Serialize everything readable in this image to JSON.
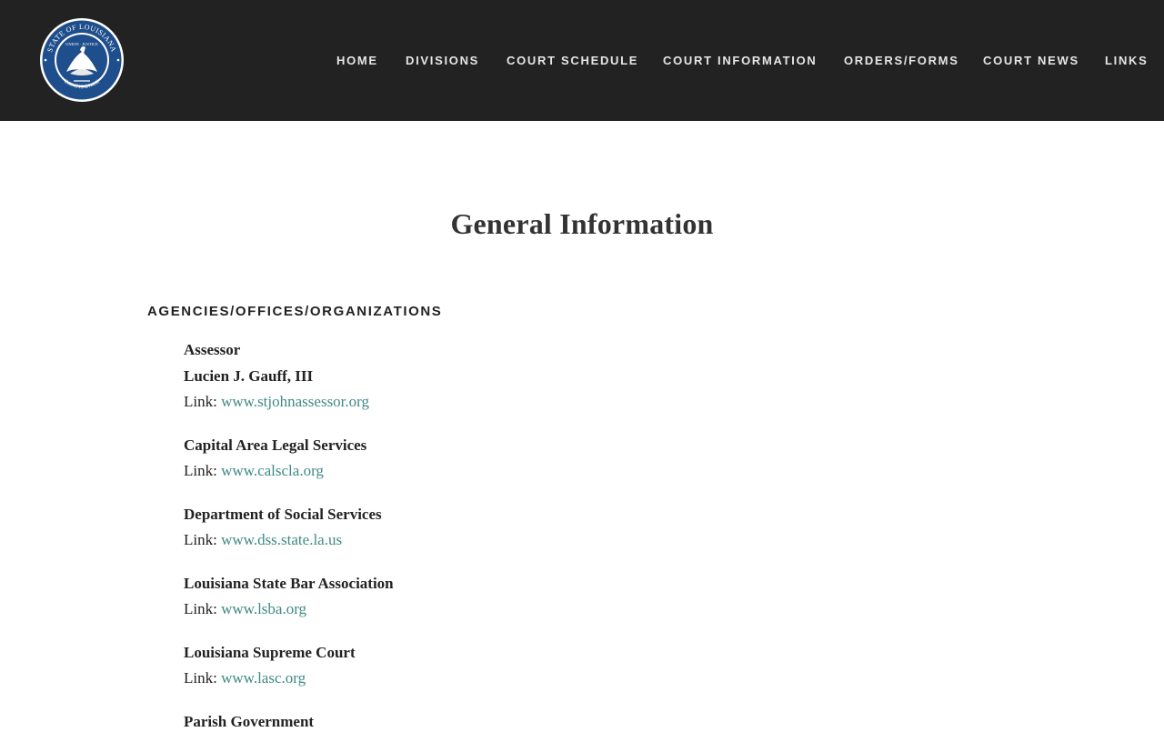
{
  "header": {
    "logo": {
      "icon": "louisiana-state-seal-icon",
      "ring_top_text": "STATE OF LOUISIANA",
      "ring_bottom_text": "CONFIDENCE",
      "motto_text": "UNION · JUSTICE",
      "colors": {
        "ring": "#1f4e8c",
        "center": "#ffffff",
        "outline": "#ffffff"
      }
    },
    "nav": [
      {
        "label": "HOME"
      },
      {
        "label": "DIVISIONS"
      },
      {
        "label": "COURT SCHEDULE"
      },
      {
        "label": "COURT INFORMATION"
      },
      {
        "label": "ORDERS/FORMS"
      },
      {
        "label": "COURT NEWS"
      },
      {
        "label": "LINKS"
      }
    ],
    "colors": {
      "background": "#222222",
      "nav_text": "#e6e6e6"
    }
  },
  "main": {
    "title": "General Information",
    "section_heading": "AGENCIES/OFFICES/ORGANIZATIONS",
    "link_prefix": "Link: ",
    "entries": [
      {
        "name": "Assessor",
        "person": "Lucien J. Gauff, III",
        "link": "www.stjohnassessor.org"
      },
      {
        "name": "Capital Area Legal Services",
        "link": "www.calscla.org"
      },
      {
        "name": "Department of Social Services",
        "link": "www.dss.state.la.us"
      },
      {
        "name": "Louisiana State Bar Association",
        "link": "www.lsba.org"
      },
      {
        "name": "Louisiana Supreme Court",
        "link": "www.lasc.org"
      },
      {
        "name": "Parish Government"
      }
    ],
    "colors": {
      "link": "#3f8a84",
      "text": "#222222"
    }
  }
}
